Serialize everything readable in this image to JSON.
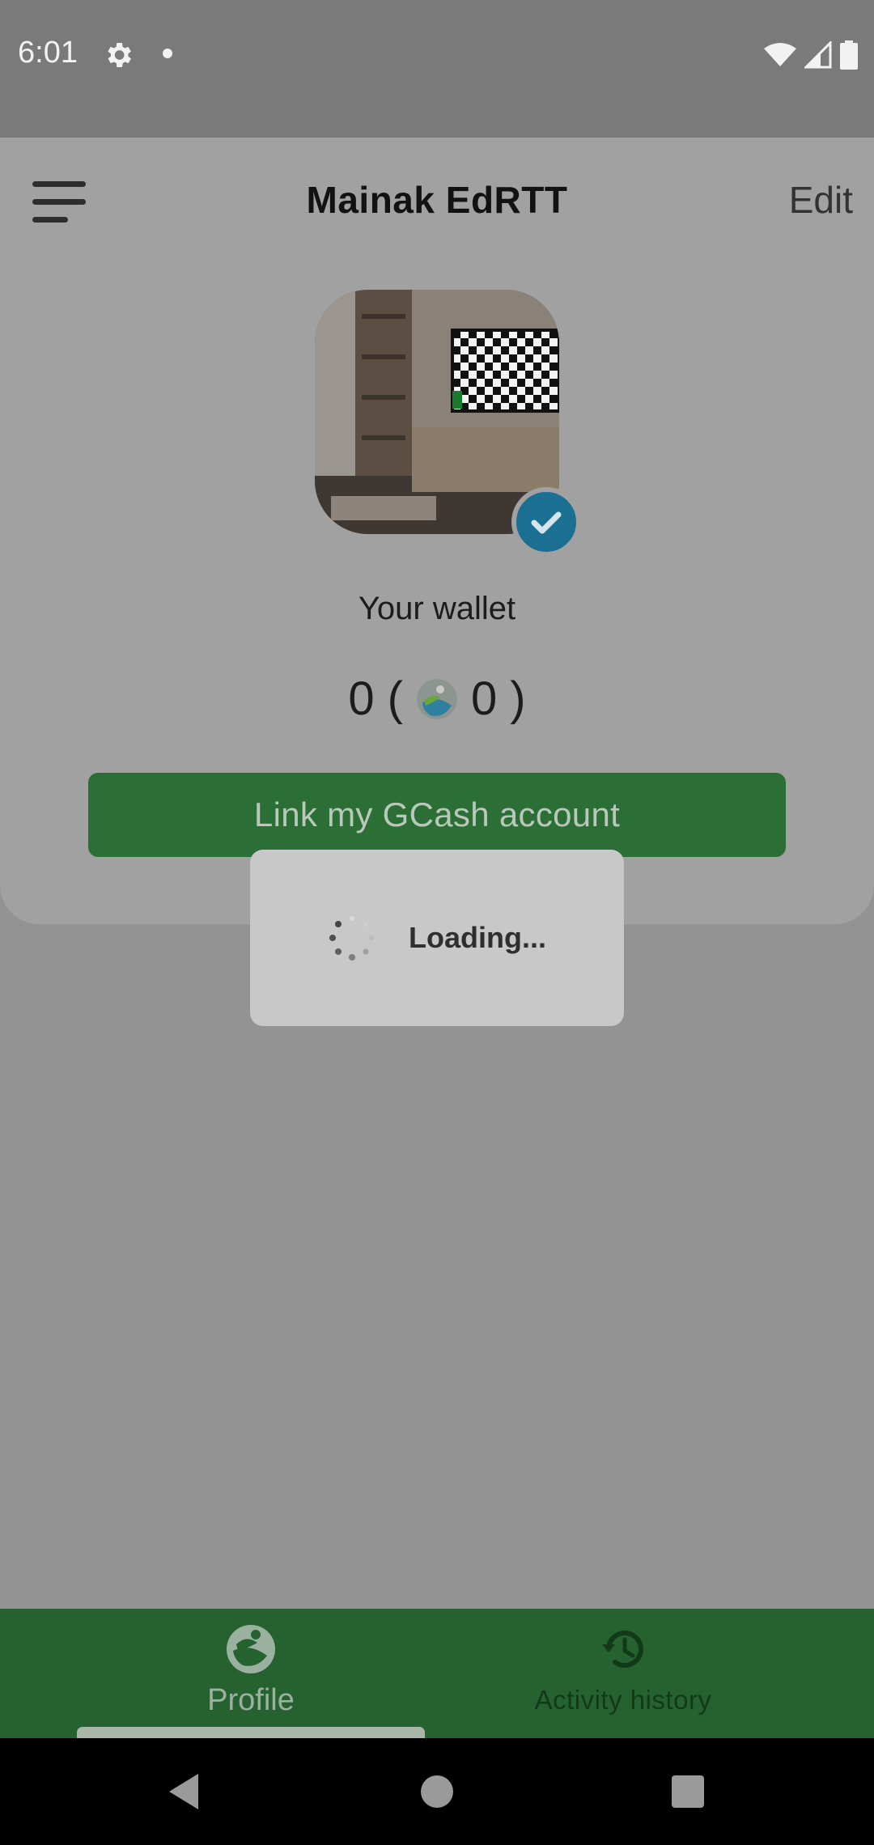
{
  "status_bar": {
    "time": "6:01"
  },
  "header": {
    "title": "Mainak EdRTT",
    "edit_label": "Edit"
  },
  "wallet": {
    "label": "Your wallet",
    "balance": "0",
    "open_paren": "(",
    "coin_balance": "0",
    "close_paren": ")"
  },
  "actions": {
    "link_gcash_label": "Link my GCash account"
  },
  "loading": {
    "text": "Loading..."
  },
  "bottom_nav": {
    "items": [
      {
        "label": "Profile",
        "icon": "profile-logo-icon",
        "active": true
      },
      {
        "label": "Activity history",
        "icon": "history-icon",
        "active": false
      }
    ]
  },
  "colors": {
    "primary_green": "#2b6e36",
    "nav_green": "#256230",
    "verified_blue": "#1b6f93"
  }
}
